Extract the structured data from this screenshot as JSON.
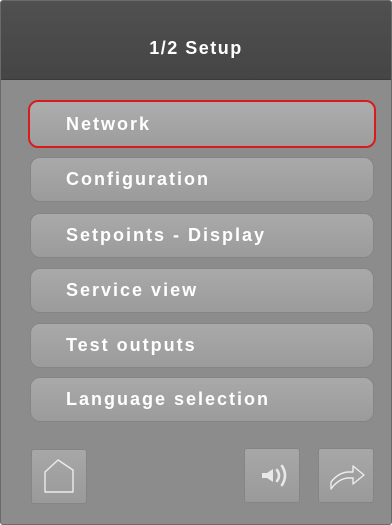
{
  "header": {
    "title": "1/2 Setup"
  },
  "menu": {
    "items": [
      {
        "label": "Network",
        "selected": true
      },
      {
        "label": "Configuration",
        "selected": false
      },
      {
        "label": "Setpoints - Display",
        "selected": false
      },
      {
        "label": "Service view",
        "selected": false
      },
      {
        "label": "Test outputs",
        "selected": false
      },
      {
        "label": "Language selection",
        "selected": false
      }
    ]
  },
  "footer": {
    "buttons": [
      {
        "icon": "home-icon"
      },
      {
        "icon": "sound-icon"
      },
      {
        "icon": "trend-icon"
      }
    ]
  },
  "colors": {
    "panel_bg": "#8c8c8c",
    "header_bg": "#4a4a4a",
    "button_bg": "#a3a3a3",
    "selected_border": "#d81c1c",
    "text": "#ffffff"
  }
}
